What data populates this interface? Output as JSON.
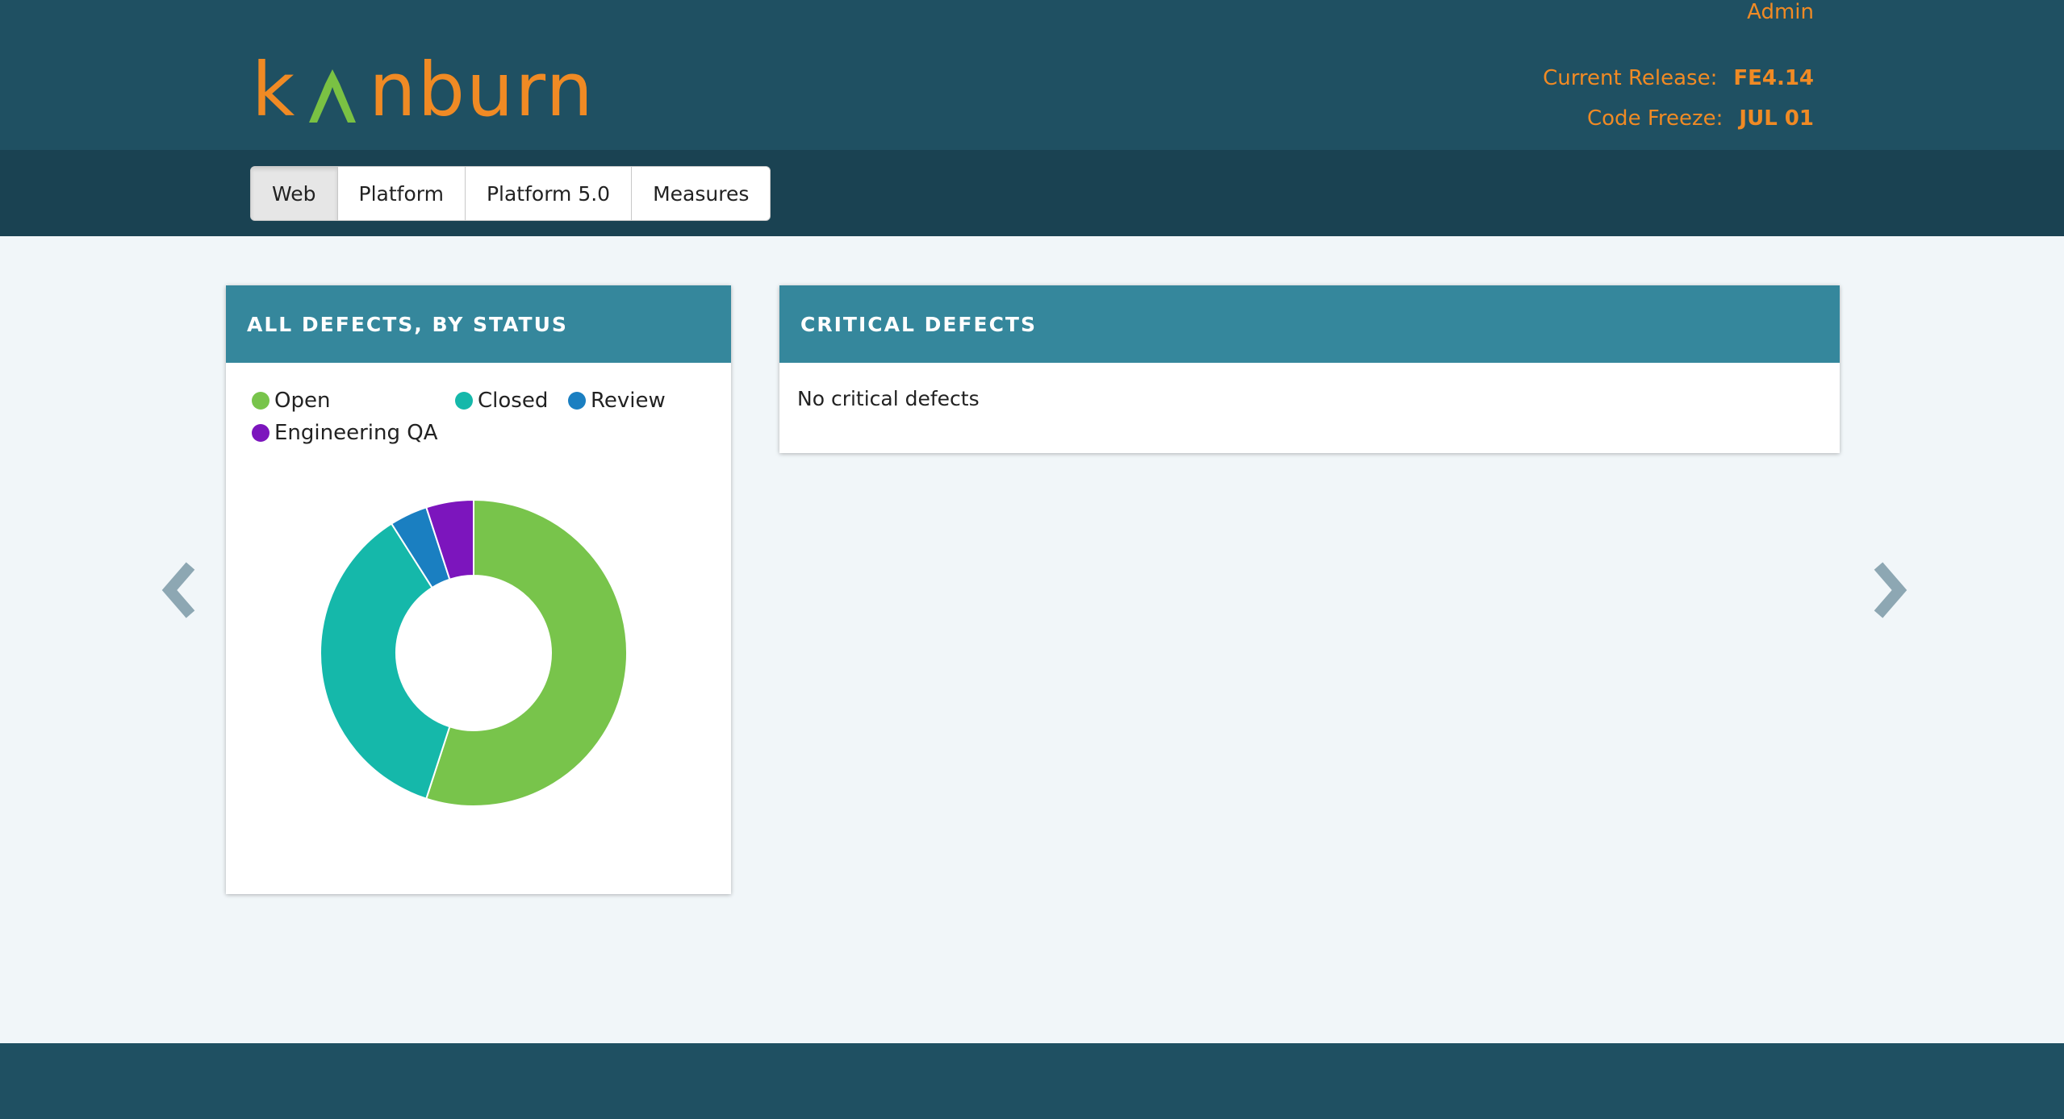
{
  "header": {
    "admin_label": "Admin",
    "logo_left": "k",
    "logo_right": "nburn",
    "current_release_label": "Current Release:",
    "current_release_value": "FE4.14",
    "code_freeze_label": "Code Freeze:",
    "code_freeze_value": "JUL 01",
    "accent_color": "#f08a24",
    "logo_mark_color": "#7ac143"
  },
  "tabs": [
    {
      "label": "Web",
      "active": true
    },
    {
      "label": "Platform",
      "active": false
    },
    {
      "label": "Platform 5.0",
      "active": false
    },
    {
      "label": "Measures",
      "active": false
    }
  ],
  "panels": {
    "defects": {
      "title": "ALL DEFECTS, BY STATUS"
    },
    "critical": {
      "title": "CRITICAL DEFECTS",
      "empty_message": "No critical defects"
    }
  },
  "navigation": {
    "prev_icon": "chevron-left-icon",
    "next_icon": "chevron-right-icon"
  },
  "chart_data": {
    "type": "pie",
    "donut": true,
    "title": "ALL DEFECTS, BY STATUS",
    "legend_position": "top",
    "series": [
      {
        "name": "Open",
        "value": 55,
        "color": "#78c44b"
      },
      {
        "name": "Closed",
        "value": 36,
        "color": "#15b8aa"
      },
      {
        "name": "Review",
        "value": 4,
        "color": "#1a7fc1"
      },
      {
        "name": "Engineering QA",
        "value": 5,
        "color": "#7c15bd"
      }
    ]
  }
}
